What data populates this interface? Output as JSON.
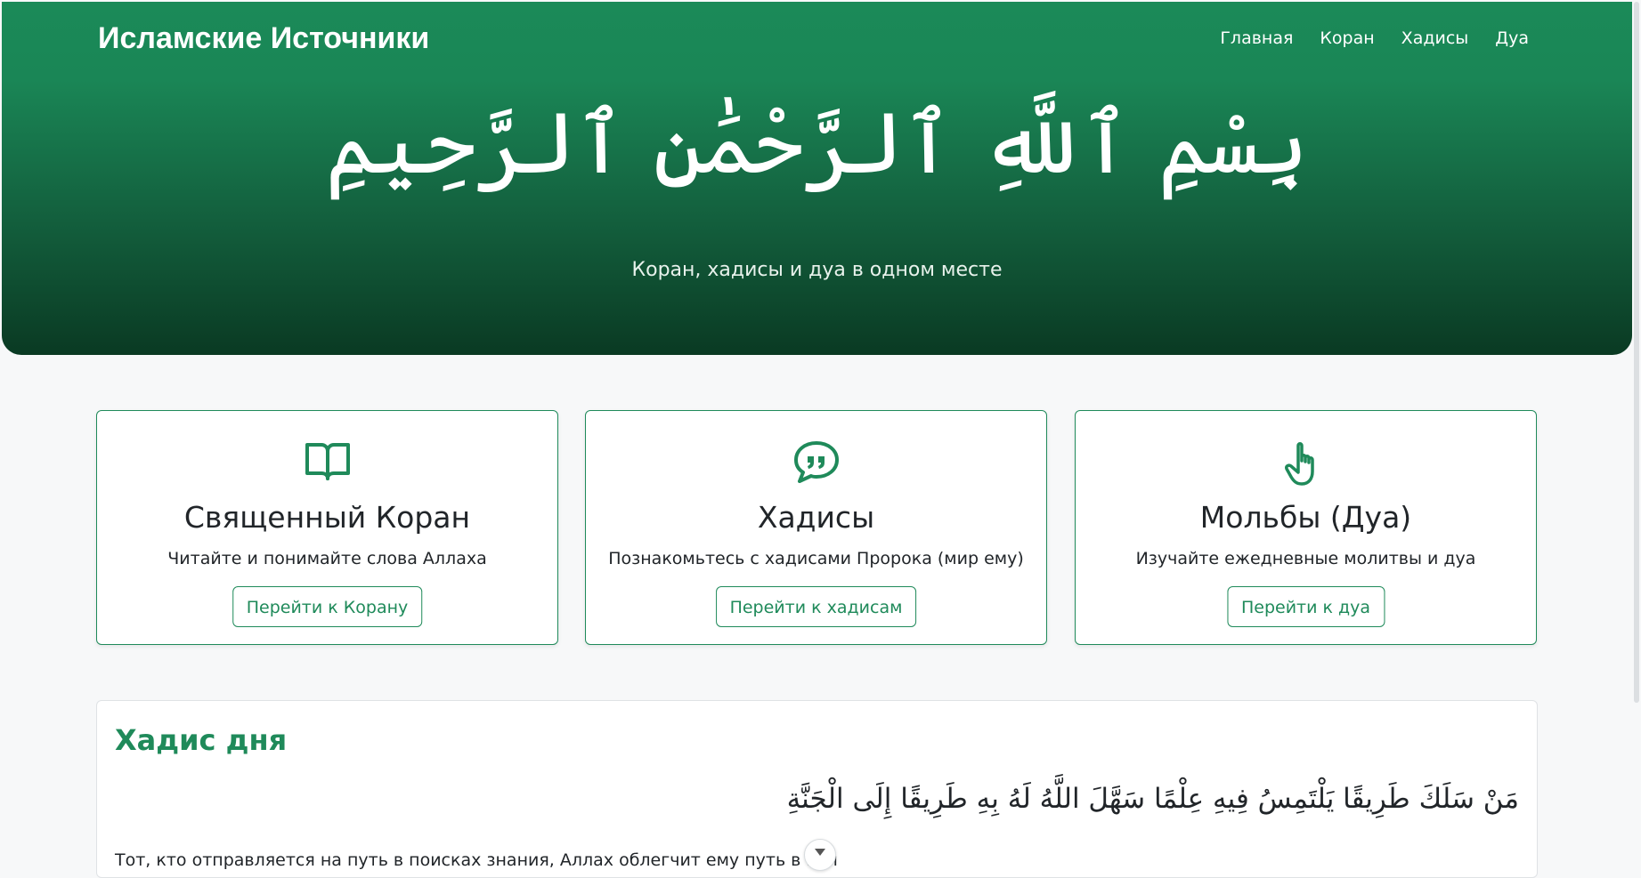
{
  "header": {
    "brand": "Исламские Источники",
    "nav": [
      "Главная",
      "Коран",
      "Хадисы",
      "Дуа"
    ]
  },
  "hero": {
    "basmala": "بِسْمِ ٱللَّهِ ٱلرَّحْمَٰنِ ٱلرَّحِيمِ",
    "tagline": "Коран, хадисы и дуа в одном месте"
  },
  "cards": [
    {
      "icon": "book-open-icon",
      "title": "Священный Коран",
      "description": "Читайте и понимайте слова Аллаха",
      "button": "Перейти к Корану"
    },
    {
      "icon": "quote-bubble-icon",
      "title": "Хадисы",
      "description": "Познакомьтесь с хадисами Пророка (мир ему)",
      "button": "Перейти к хадисам"
    },
    {
      "icon": "pointing-hand-icon",
      "title": "Мольбы (Дуа)",
      "description": "Изучайте ежедневные молитвы и дуа",
      "button": "Перейти к дуа"
    }
  ],
  "hadith_of_day": {
    "heading": "Хадис дня",
    "arabic": "مَنْ سَلَكَ طَرِيقًا يَلْتَمِسُ فِيهِ عِلْمًا سَهَّلَ اللَّهُ لَهُ بِهِ طَرِيقًا إِلَى الْجَنَّةِ",
    "translation": "Тот, кто отправляется на путь в поисках знания, Аллах облегчит ему путь в Рай"
  },
  "colors": {
    "accent": "#1f8a5a",
    "hero_top": "#1b8a58",
    "hero_bottom": "#0a3a23",
    "background": "#f7f8f9"
  }
}
